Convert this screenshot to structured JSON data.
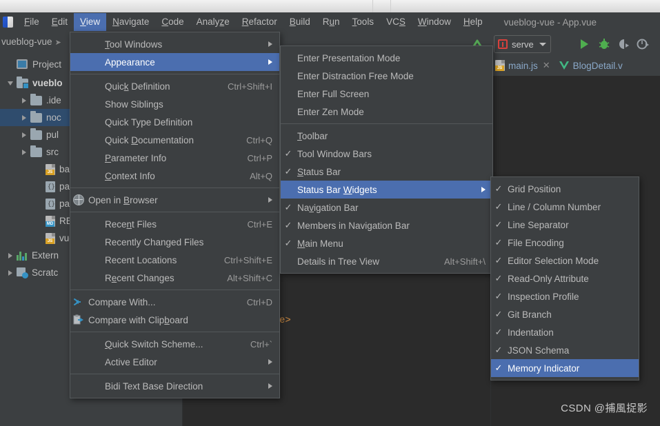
{
  "window": {
    "title": "vueblog-vue - App.vue"
  },
  "menubar": {
    "items": [
      {
        "label": "File",
        "mnemonic": "F"
      },
      {
        "label": "Edit",
        "mnemonic": "E"
      },
      {
        "label": "View",
        "mnemonic": "V"
      },
      {
        "label": "Navigate",
        "mnemonic": "N"
      },
      {
        "label": "Code",
        "mnemonic": "C"
      },
      {
        "label": "Analyze",
        "mnemonic": "z"
      },
      {
        "label": "Refactor",
        "mnemonic": "R"
      },
      {
        "label": "Build",
        "mnemonic": "B"
      },
      {
        "label": "Run",
        "mnemonic": "u"
      },
      {
        "label": "Tools",
        "mnemonic": "T"
      },
      {
        "label": "VCS",
        "mnemonic": "S"
      },
      {
        "label": "Window",
        "mnemonic": "W"
      },
      {
        "label": "Help",
        "mnemonic": "H"
      }
    ],
    "active": "View"
  },
  "toolbar": {
    "breadcrumb": "vueblog-vue",
    "run_config_label": "serve",
    "run_config_icon": "vue-config-icon",
    "buttons": [
      "run-button",
      "debug-button",
      "coverage-button",
      "profile-button"
    ]
  },
  "tabs": [
    {
      "label": "main.js",
      "icon": "js-file-icon",
      "closable": true
    },
    {
      "label": "BlogDetail.v",
      "icon": "vue-file-icon",
      "closable": false
    }
  ],
  "editor": {
    "code_fragment": "e>"
  },
  "project_panel": {
    "title": "Project",
    "icon": "project-icon",
    "tree": [
      {
        "label": "vueblo",
        "indent": 0,
        "twist": "down",
        "icon": "folder-module",
        "bold": true,
        "selected": false
      },
      {
        "label": ".ide",
        "indent": 1,
        "twist": "right",
        "icon": "folder",
        "bold": false,
        "selected": false
      },
      {
        "label": "noc",
        "indent": 1,
        "twist": "right",
        "icon": "folder",
        "bold": false,
        "selected": true
      },
      {
        "label": "pul",
        "indent": 1,
        "twist": "right",
        "icon": "folder",
        "bold": false,
        "selected": false
      },
      {
        "label": "src",
        "indent": 1,
        "twist": "right",
        "icon": "folder",
        "bold": false,
        "selected": false
      },
      {
        "label": "bab",
        "indent": 2,
        "twist": "none",
        "icon": "js-file",
        "bold": false,
        "selected": false
      },
      {
        "label": "pac",
        "indent": 2,
        "twist": "none",
        "icon": "json-file",
        "bold": false,
        "selected": false
      },
      {
        "label": "pac",
        "indent": 2,
        "twist": "none",
        "icon": "json-file",
        "bold": false,
        "selected": false
      },
      {
        "label": "REA",
        "indent": 2,
        "twist": "none",
        "icon": "md-file",
        "bold": false,
        "selected": false
      },
      {
        "label": "vue",
        "indent": 2,
        "twist": "none",
        "icon": "js-file",
        "bold": false,
        "selected": false
      },
      {
        "label": "Extern",
        "indent": 0,
        "twist": "right",
        "icon": "library",
        "bold": false,
        "selected": false
      },
      {
        "label": "Scratc",
        "indent": 0,
        "twist": "right",
        "icon": "scratch",
        "bold": false,
        "selected": false
      }
    ]
  },
  "menu_view": {
    "title": "View",
    "items": [
      {
        "label": "Tool Windows",
        "mnemonic": "T",
        "shortcut": "",
        "submenu": true,
        "check": false,
        "icon": "",
        "highlighted": false
      },
      {
        "label": "Appearance",
        "mnemonic": "",
        "shortcut": "",
        "submenu": true,
        "check": false,
        "icon": "",
        "highlighted": true
      },
      {
        "separator": true
      },
      {
        "label": "Quick Definition",
        "mnemonic": "k",
        "shortcut": "Ctrl+Shift+I",
        "submenu": false,
        "check": false,
        "icon": "",
        "highlighted": false
      },
      {
        "label": "Show Siblings",
        "mnemonic": "",
        "shortcut": "",
        "submenu": false,
        "check": false,
        "icon": "",
        "highlighted": false
      },
      {
        "label": "Quick Type Definition",
        "mnemonic": "",
        "shortcut": "",
        "submenu": false,
        "check": false,
        "icon": "",
        "highlighted": false
      },
      {
        "label": "Quick Documentation",
        "mnemonic": "D",
        "shortcut": "Ctrl+Q",
        "submenu": false,
        "check": false,
        "icon": "",
        "highlighted": false
      },
      {
        "label": "Parameter Info",
        "mnemonic": "P",
        "shortcut": "Ctrl+P",
        "submenu": false,
        "check": false,
        "icon": "",
        "highlighted": false
      },
      {
        "label": "Context Info",
        "mnemonic": "C",
        "shortcut": "Alt+Q",
        "submenu": false,
        "check": false,
        "icon": "",
        "highlighted": false
      },
      {
        "separator": true
      },
      {
        "label": "Open in Browser",
        "mnemonic": "B",
        "shortcut": "",
        "submenu": true,
        "check": false,
        "icon": "globe-icon",
        "highlighted": false
      },
      {
        "separator": true
      },
      {
        "label": "Recent Files",
        "mnemonic": "n",
        "shortcut": "Ctrl+E",
        "submenu": false,
        "check": false,
        "icon": "",
        "highlighted": false
      },
      {
        "label": "Recently Changed Files",
        "mnemonic": "",
        "shortcut": "",
        "submenu": false,
        "check": false,
        "icon": "",
        "highlighted": false
      },
      {
        "label": "Recent Locations",
        "mnemonic": "",
        "shortcut": "Ctrl+Shift+E",
        "submenu": false,
        "check": false,
        "icon": "",
        "highlighted": false
      },
      {
        "label": "Recent Changes",
        "mnemonic": "e",
        "shortcut": "Alt+Shift+C",
        "submenu": false,
        "check": false,
        "icon": "",
        "highlighted": false
      },
      {
        "separator": true
      },
      {
        "label": "Compare With...",
        "mnemonic": "",
        "shortcut": "Ctrl+D",
        "submenu": false,
        "check": false,
        "icon": "compare-icon",
        "highlighted": false
      },
      {
        "label": "Compare with Clipboard",
        "mnemonic": "b",
        "shortcut": "",
        "submenu": false,
        "check": false,
        "icon": "compare-clipboard-icon",
        "highlighted": false
      },
      {
        "separator": true
      },
      {
        "label": "Quick Switch Scheme...",
        "mnemonic": "Q",
        "shortcut": "Ctrl+`",
        "submenu": false,
        "check": false,
        "icon": "",
        "highlighted": false
      },
      {
        "label": "Active Editor",
        "mnemonic": "",
        "shortcut": "",
        "submenu": true,
        "check": false,
        "icon": "",
        "highlighted": false
      },
      {
        "separator": true
      },
      {
        "label": "Bidi Text Base Direction",
        "mnemonic": "",
        "shortcut": "",
        "submenu": true,
        "check": false,
        "icon": "",
        "highlighted": false
      }
    ]
  },
  "menu_appearance": {
    "title": "Appearance",
    "items": [
      {
        "label": "Enter Presentation Mode",
        "shortcut": "",
        "submenu": false,
        "check": false,
        "highlighted": false
      },
      {
        "label": "Enter Distraction Free Mode",
        "shortcut": "",
        "submenu": false,
        "check": false,
        "highlighted": false
      },
      {
        "label": "Enter Full Screen",
        "shortcut": "",
        "submenu": false,
        "check": false,
        "highlighted": false
      },
      {
        "label": "Enter Zen Mode",
        "shortcut": "",
        "submenu": false,
        "check": false,
        "highlighted": false
      },
      {
        "separator": true
      },
      {
        "label": "Toolbar",
        "mnemonic": "T",
        "shortcut": "",
        "submenu": false,
        "check": false,
        "highlighted": false
      },
      {
        "label": "Tool Window Bars",
        "shortcut": "",
        "submenu": false,
        "check": true,
        "highlighted": false
      },
      {
        "label": "Status Bar",
        "mnemonic": "S",
        "shortcut": "",
        "submenu": false,
        "check": true,
        "highlighted": false
      },
      {
        "label": "Status Bar Widgets",
        "mnemonic": "W",
        "shortcut": "",
        "submenu": true,
        "check": false,
        "highlighted": true
      },
      {
        "label": "Navigation Bar",
        "mnemonic": "v",
        "shortcut": "",
        "submenu": false,
        "check": true,
        "highlighted": false
      },
      {
        "label": "Members in Navigation Bar",
        "shortcut": "",
        "submenu": false,
        "check": true,
        "highlighted": false
      },
      {
        "label": "Main Menu",
        "mnemonic": "M",
        "shortcut": "",
        "submenu": false,
        "check": true,
        "highlighted": false
      },
      {
        "label": "Details in Tree View",
        "shortcut": "Alt+Shift+\\",
        "submenu": false,
        "check": false,
        "highlighted": false
      }
    ]
  },
  "menu_widgets": {
    "title": "Status Bar Widgets",
    "items": [
      {
        "label": "Grid Position",
        "check": true,
        "highlighted": false
      },
      {
        "label": "Line / Column Number",
        "check": true,
        "highlighted": false
      },
      {
        "label": "Line Separator",
        "check": true,
        "highlighted": false
      },
      {
        "label": "File Encoding",
        "check": true,
        "highlighted": false
      },
      {
        "label": "Editor Selection Mode",
        "check": true,
        "highlighted": false
      },
      {
        "label": "Read-Only Attribute",
        "check": true,
        "highlighted": false
      },
      {
        "label": "Inspection Profile",
        "check": true,
        "highlighted": false
      },
      {
        "label": "Git Branch",
        "check": true,
        "highlighted": false
      },
      {
        "label": "Indentation",
        "check": true,
        "highlighted": false
      },
      {
        "label": "JSON Schema",
        "check": true,
        "highlighted": false
      },
      {
        "label": "Memory Indicator",
        "check": true,
        "highlighted": true
      }
    ]
  },
  "watermark": "CSDN @捕風捉影",
  "colors": {
    "menu_bg": "#3c3f41",
    "selection_blue": "#4b6eaf",
    "editor_bg": "#2b2b2b",
    "tree_selection": "#2f4c6d",
    "text": "#bbbbbb",
    "shortcut_text": "#9b9b9b",
    "accent_green": "#4fae4f",
    "accent_red": "#d9413c"
  }
}
